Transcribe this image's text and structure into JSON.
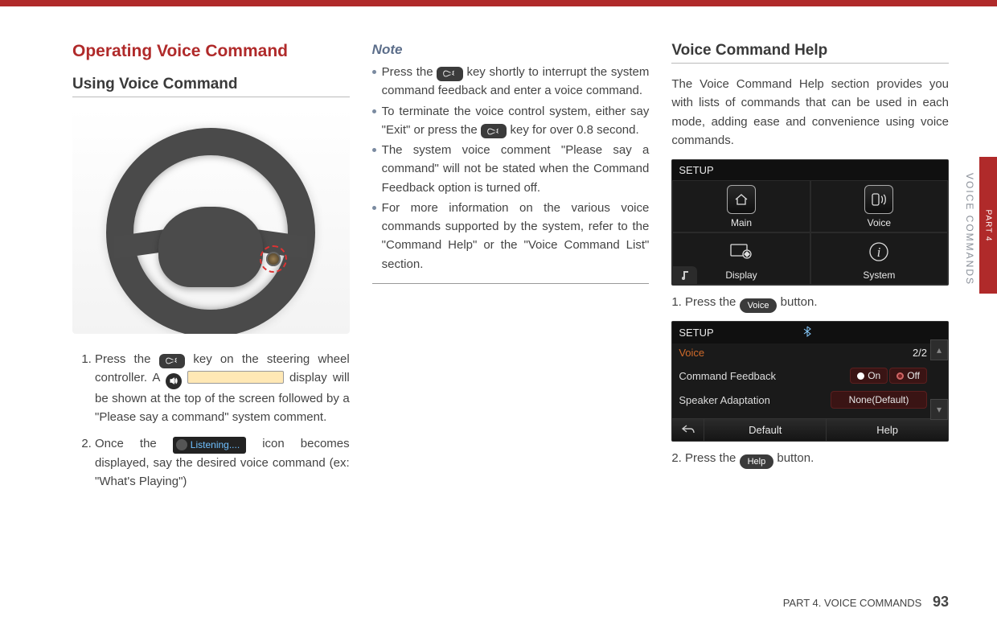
{
  "sideTab": {
    "part": "PART 4"
  },
  "sideLabel": "VOICE COMMANDS",
  "col1": {
    "mainHeading": "Operating Voice Command",
    "subHeading": "Using Voice Command",
    "step1_a": "Press the ",
    "step1_b": " key on the steering wheel controller. A ",
    "step1_c": " display will be shown at the top of the screen followed by a \"Please say a command\" system comment.",
    "step2_a": "Once the ",
    "step2_b": " icon becomes displayed, say the desired voice command (ex: \"What's Playing\")",
    "listeningLabel": "Listening...."
  },
  "col2": {
    "noteHeading": "Note",
    "n1_a": "Press the ",
    "n1_b": " key shortly to interrupt the system command feedback and enter a voice command.",
    "n2_a": "To terminate the voice control system, either say \"Exit\" or press the ",
    "n2_b": " key for over 0.8 second.",
    "n3": "The system voice comment \"Please say a command\" will not be stated when the Command Feedback option is turned off.",
    "n4": "For more information on the various voice commands supported by the system, refer to the \"Command Help\" or the \"Voice Command List\" section."
  },
  "col3": {
    "heading": "Voice Command Help",
    "intro": "The Voice Command Help section provides you with lists of commands that can be used in each mode, adding ease and convenience using voice commands.",
    "setupTitle": "SETUP",
    "tiles": {
      "main": "Main",
      "voice": "Voice",
      "display": "Display",
      "system": "System"
    },
    "step1_a": "1. Press the ",
    "step1_btn": "Voice",
    "step1_b": " button.",
    "scr2": {
      "tabVoice": "Voice",
      "pager": "2/2",
      "row1": "Command Feedback",
      "row1_on": "On",
      "row1_off": "Off",
      "row2": "Speaker Adaptation",
      "row2_val": "None(Default)",
      "btnDefault": "Default",
      "btnHelp": "Help"
    },
    "step2_a": "2. Press the ",
    "step2_btn": "Help",
    "step2_b": " button."
  },
  "footer": {
    "part": "PART 4. VOICE COMMANDS",
    "page": "93"
  }
}
